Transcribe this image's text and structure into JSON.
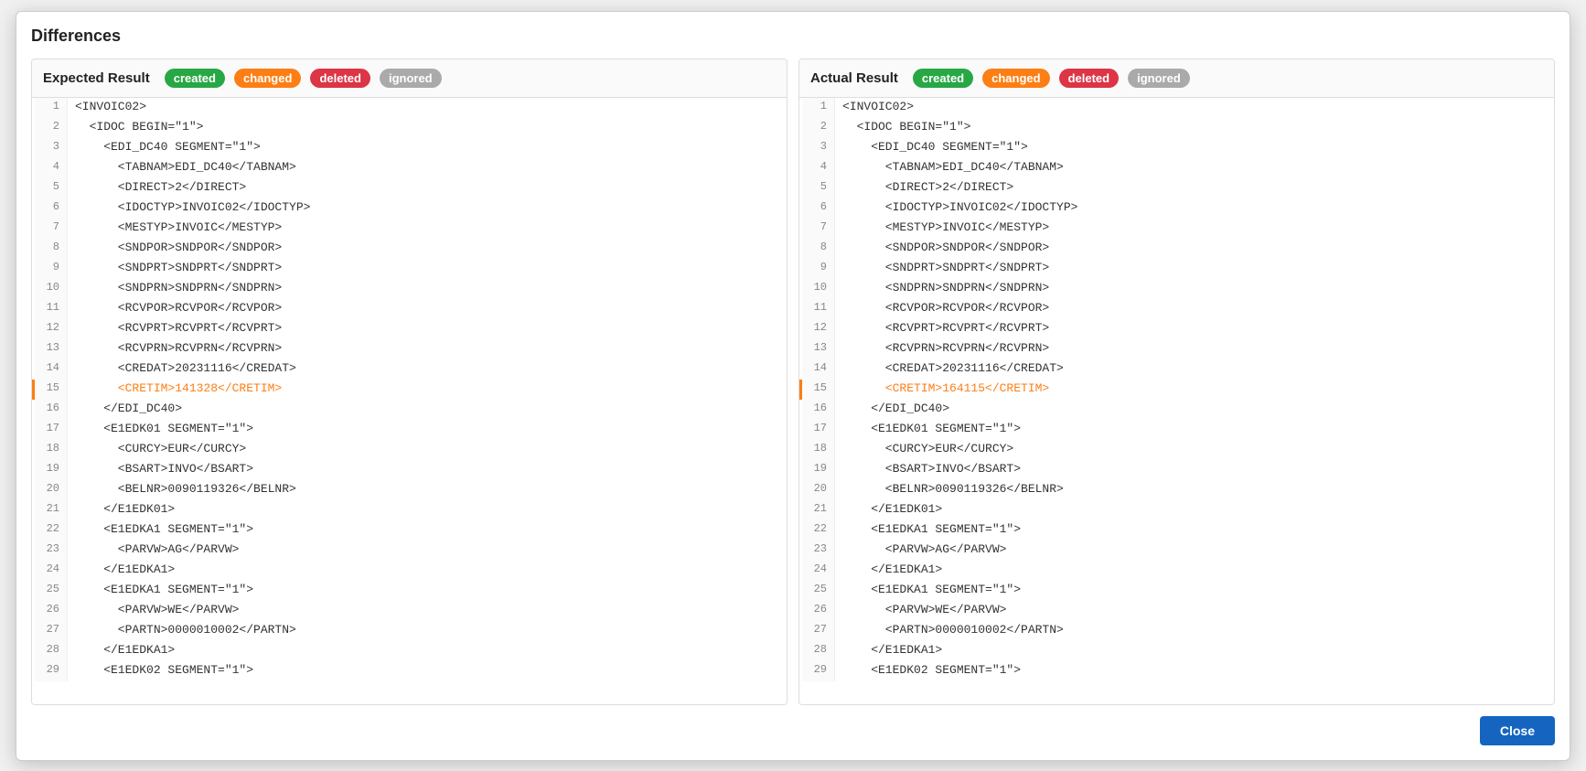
{
  "dialog": {
    "title": "Differences",
    "close_label": "Close"
  },
  "badges": {
    "created": "created",
    "changed": "changed",
    "deleted": "deleted",
    "ignored": "ignored"
  },
  "left_panel": {
    "title": "Expected Result",
    "lines": [
      {
        "num": 1,
        "text": "<INVOIC02>",
        "changed": false
      },
      {
        "num": 2,
        "text": "  <IDOC BEGIN=\"1\">",
        "changed": false
      },
      {
        "num": 3,
        "text": "    <EDI_DC40 SEGMENT=\"1\">",
        "changed": false
      },
      {
        "num": 4,
        "text": "      <TABNAM>EDI_DC40</TABNAM>",
        "changed": false
      },
      {
        "num": 5,
        "text": "      <DIRECT>2</DIRECT>",
        "changed": false
      },
      {
        "num": 6,
        "text": "      <IDOCTYP>INVOIC02</IDOCTYP>",
        "changed": false
      },
      {
        "num": 7,
        "text": "      <MESTYP>INVOIC</MESTYP>",
        "changed": false
      },
      {
        "num": 8,
        "text": "      <SNDPOR>SNDPOR</SNDPOR>",
        "changed": false
      },
      {
        "num": 9,
        "text": "      <SNDPRT>SNDPRT</SNDPRT>",
        "changed": false
      },
      {
        "num": 10,
        "text": "      <SNDPRN>SNDPRN</SNDPRN>",
        "changed": false
      },
      {
        "num": 11,
        "text": "      <RCVPOR>RCVPOR</RCVPOR>",
        "changed": false
      },
      {
        "num": 12,
        "text": "      <RCVPRT>RCVPRT</RCVPRT>",
        "changed": false
      },
      {
        "num": 13,
        "text": "      <RCVPRN>RCVPRN</RCVPRN>",
        "changed": false
      },
      {
        "num": 14,
        "text": "      <CREDAT>20231116</CREDAT>",
        "changed": false
      },
      {
        "num": 15,
        "text": "      <CRETIM>141328</CRETIM>",
        "changed": true
      },
      {
        "num": 16,
        "text": "    </EDI_DC40>",
        "changed": false
      },
      {
        "num": 17,
        "text": "    <E1EDK01 SEGMENT=\"1\">",
        "changed": false
      },
      {
        "num": 18,
        "text": "      <CURCY>EUR</CURCY>",
        "changed": false
      },
      {
        "num": 19,
        "text": "      <BSART>INVO</BSART>",
        "changed": false
      },
      {
        "num": 20,
        "text": "      <BELNR>0090119326</BELNR>",
        "changed": false
      },
      {
        "num": 21,
        "text": "    </E1EDK01>",
        "changed": false
      },
      {
        "num": 22,
        "text": "    <E1EDKA1 SEGMENT=\"1\">",
        "changed": false
      },
      {
        "num": 23,
        "text": "      <PARVW>AG</PARVW>",
        "changed": false
      },
      {
        "num": 24,
        "text": "    </E1EDKA1>",
        "changed": false
      },
      {
        "num": 25,
        "text": "    <E1EDKA1 SEGMENT=\"1\">",
        "changed": false
      },
      {
        "num": 26,
        "text": "      <PARVW>WE</PARVW>",
        "changed": false
      },
      {
        "num": 27,
        "text": "      <PARTN>0000010002</PARTN>",
        "changed": false
      },
      {
        "num": 28,
        "text": "    </E1EDKA1>",
        "changed": false
      },
      {
        "num": 29,
        "text": "    <E1EDK02 SEGMENT=\"1\">",
        "changed": false
      }
    ]
  },
  "right_panel": {
    "title": "Actual Result",
    "lines": [
      {
        "num": 1,
        "text": "<INVOIC02>",
        "changed": false
      },
      {
        "num": 2,
        "text": "  <IDOC BEGIN=\"1\">",
        "changed": false
      },
      {
        "num": 3,
        "text": "    <EDI_DC40 SEGMENT=\"1\">",
        "changed": false
      },
      {
        "num": 4,
        "text": "      <TABNAM>EDI_DC40</TABNAM>",
        "changed": false
      },
      {
        "num": 5,
        "text": "      <DIRECT>2</DIRECT>",
        "changed": false
      },
      {
        "num": 6,
        "text": "      <IDOCTYP>INVOIC02</IDOCTYP>",
        "changed": false
      },
      {
        "num": 7,
        "text": "      <MESTYP>INVOIC</MESTYP>",
        "changed": false
      },
      {
        "num": 8,
        "text": "      <SNDPOR>SNDPOR</SNDPOR>",
        "changed": false
      },
      {
        "num": 9,
        "text": "      <SNDPRT>SNDPRT</SNDPRT>",
        "changed": false
      },
      {
        "num": 10,
        "text": "      <SNDPRN>SNDPRN</SNDPRN>",
        "changed": false
      },
      {
        "num": 11,
        "text": "      <RCVPOR>RCVPOR</RCVPOR>",
        "changed": false
      },
      {
        "num": 12,
        "text": "      <RCVPRT>RCVPRT</RCVPRT>",
        "changed": false
      },
      {
        "num": 13,
        "text": "      <RCVPRN>RCVPRN</RCVPRN>",
        "changed": false
      },
      {
        "num": 14,
        "text": "      <CREDAT>20231116</CREDAT>",
        "changed": false
      },
      {
        "num": 15,
        "text": "      <CRETIM>164115</CRETIM>",
        "changed": true
      },
      {
        "num": 16,
        "text": "    </EDI_DC40>",
        "changed": false
      },
      {
        "num": 17,
        "text": "    <E1EDK01 SEGMENT=\"1\">",
        "changed": false
      },
      {
        "num": 18,
        "text": "      <CURCY>EUR</CURCY>",
        "changed": false
      },
      {
        "num": 19,
        "text": "      <BSART>INVO</BSART>",
        "changed": false
      },
      {
        "num": 20,
        "text": "      <BELNR>0090119326</BELNR>",
        "changed": false
      },
      {
        "num": 21,
        "text": "    </E1EDK01>",
        "changed": false
      },
      {
        "num": 22,
        "text": "    <E1EDKA1 SEGMENT=\"1\">",
        "changed": false
      },
      {
        "num": 23,
        "text": "      <PARVW>AG</PARVW>",
        "changed": false
      },
      {
        "num": 24,
        "text": "    </E1EDKA1>",
        "changed": false
      },
      {
        "num": 25,
        "text": "    <E1EDKA1 SEGMENT=\"1\">",
        "changed": false
      },
      {
        "num": 26,
        "text": "      <PARVW>WE</PARVW>",
        "changed": false
      },
      {
        "num": 27,
        "text": "      <PARTN>0000010002</PARTN>",
        "changed": false
      },
      {
        "num": 28,
        "text": "    </E1EDKA1>",
        "changed": false
      },
      {
        "num": 29,
        "text": "    <E1EDK02 SEGMENT=\"1\">",
        "changed": false
      }
    ]
  }
}
